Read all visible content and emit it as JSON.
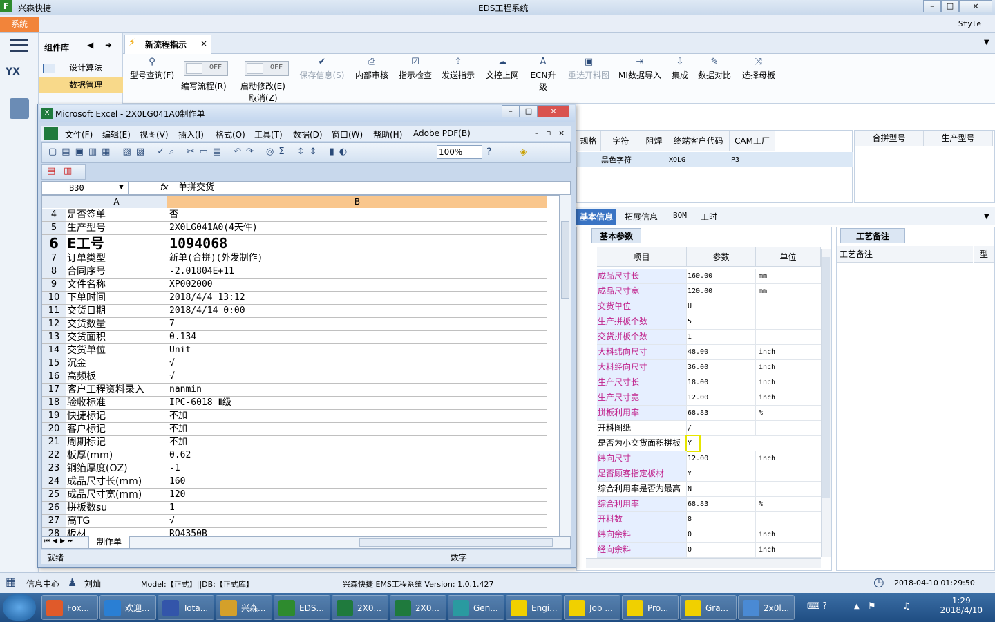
{
  "app": {
    "logo": "F",
    "name": "兴森快捷",
    "title": "EDS工程系统",
    "style_label": "Style"
  },
  "menu": {
    "system": "系统"
  },
  "left": {
    "component_lib": "组件库",
    "items": [
      {
        "label": "设计算法"
      },
      {
        "label": "数据管理"
      }
    ]
  },
  "tab": {
    "label": "新流程指示",
    "close": "×"
  },
  "toolbar": {
    "model_query": "型号查询(F)",
    "toggle1_state": "OFF",
    "toggle1_label": "编写流程(R)",
    "toggle2_state": "OFF",
    "toggle2_label": "启动修改(E)",
    "cancel": "取消(Z)",
    "save_info": "保存信息(S)",
    "internal_review": "内部审核",
    "check": "指示检查",
    "send": "发送指示",
    "doc_upload": "文控上网",
    "ecn": "ECN升级",
    "reselect": "重选开料图",
    "mi_import": "MI数据导入",
    "integrate": "集成",
    "compare": "数据对比",
    "select_mother": "选择母板"
  },
  "top_grid": {
    "headers": [
      "规格",
      "字符",
      "阻焊",
      "终端客户代码",
      "CAM工厂"
    ],
    "row": [
      "黑色字符",
      "",
      "XOLG",
      "P3"
    ]
  },
  "model_grid": {
    "headers": [
      "合拼型号",
      "生产型号"
    ]
  },
  "bottom_tabs": [
    "基本信息",
    "拓展信息",
    "BOM",
    "工时"
  ],
  "basic_params": {
    "tab": "基本参数",
    "headers": [
      "项目",
      "参数",
      "单位"
    ],
    "rows": [
      {
        "k": "成品尺寸长",
        "v": "160.00",
        "u": "mm",
        "red": true
      },
      {
        "k": "成品尺寸宽",
        "v": "120.00",
        "u": "mm",
        "red": true
      },
      {
        "k": "交货单位",
        "v": "U",
        "u": "",
        "red": true
      },
      {
        "k": "生产拼板个数",
        "v": "5",
        "u": "",
        "red": true
      },
      {
        "k": "交货拼板个数",
        "v": "1",
        "u": "",
        "red": true
      },
      {
        "k": "大料纬向尺寸",
        "v": "48.00",
        "u": "inch",
        "red": true
      },
      {
        "k": "大料经向尺寸",
        "v": "36.00",
        "u": "inch",
        "red": true
      },
      {
        "k": "生产尺寸长",
        "v": "18.00",
        "u": "inch",
        "red": true
      },
      {
        "k": "生产尺寸宽",
        "v": "12.00",
        "u": "inch",
        "red": true
      },
      {
        "k": "拼板利用率",
        "v": "68.83",
        "u": "%",
        "red": true
      },
      {
        "k": "开料图纸",
        "v": "/",
        "u": "",
        "red": false
      },
      {
        "k": "是否为小交货面积拼板",
        "v": "Y",
        "u": "",
        "red": false
      },
      {
        "k": "纬向尺寸",
        "v": "12.00",
        "u": "inch",
        "red": true
      },
      {
        "k": "是否顾客指定板材",
        "v": "Y",
        "u": "",
        "red": true
      },
      {
        "k": "综合利用率是否为最高",
        "v": "N",
        "u": "",
        "red": false
      },
      {
        "k": "综合利用率",
        "v": "68.83",
        "u": "%",
        "red": true
      },
      {
        "k": "开料数",
        "v": "8",
        "u": "",
        "red": true
      },
      {
        "k": "纬向余料",
        "v": "0",
        "u": "inch",
        "red": true
      },
      {
        "k": "经向余料",
        "v": "0",
        "u": "inch",
        "red": true
      }
    ]
  },
  "remark": {
    "tab": "工艺备注",
    "header": "工艺备注",
    "col": "型"
  },
  "status": {
    "info_center": "信息中心",
    "user": "刘灿",
    "model": "Model:【正式】||DB:【正式库】",
    "system": "兴森快捷 EMS工程系统 Version: 1.0.1.427",
    "datetime": "2018-04-10 01:29:50"
  },
  "excel": {
    "title": "Microsoft Excel - 2X0LG041A0制作单",
    "menus": [
      "文件(F)",
      "编辑(E)",
      "视图(V)",
      "插入(I)",
      "格式(O)",
      "工具(T)",
      "数据(D)",
      "窗口(W)",
      "帮助(H)",
      "Adobe PDF(B)"
    ],
    "zoom": "100%",
    "namebox": "B30",
    "fx": "fx",
    "formula": "单拼交货",
    "col_a": "A",
    "col_b": "B",
    "rows": [
      {
        "n": "4",
        "a": "是否签单",
        "b": "否"
      },
      {
        "n": "5",
        "a": "生产型号",
        "b": "2X0LG041A0(4天件)"
      },
      {
        "n": "6",
        "a": "E工号",
        "b": "1094068",
        "big": true
      },
      {
        "n": "7",
        "a": "订单类型",
        "b": "新单(合拼)(外发制作)"
      },
      {
        "n": "8",
        "a": "合同序号",
        "b": "-2.01804E+11"
      },
      {
        "n": "9",
        "a": "文件名称",
        "b": "XP002000"
      },
      {
        "n": "10",
        "a": "下单时间",
        "b": "2018/4/4 13:12"
      },
      {
        "n": "11",
        "a": "交货日期",
        "b": "2018/4/14 0:00"
      },
      {
        "n": "12",
        "a": "交货数量",
        "b": "7"
      },
      {
        "n": "13",
        "a": "交货面积",
        "b": "0.134"
      },
      {
        "n": "14",
        "a": "交货单位",
        "b": "Unit"
      },
      {
        "n": "15",
        "a": "沉金",
        "b": "√"
      },
      {
        "n": "16",
        "a": "高频板",
        "b": "√"
      },
      {
        "n": "17",
        "a": "客户工程资料录入",
        "b": "nanmin"
      },
      {
        "n": "18",
        "a": "验收标准",
        "b": "IPC-6018 Ⅱ级"
      },
      {
        "n": "19",
        "a": "快捷标记",
        "b": "不加"
      },
      {
        "n": "20",
        "a": "客户标记",
        "b": "不加"
      },
      {
        "n": "21",
        "a": "周期标记",
        "b": "不加"
      },
      {
        "n": "22",
        "a": "板厚(mm)",
        "b": "0.62"
      },
      {
        "n": "23",
        "a": "铜箔厚度(OZ)",
        "b": "-1"
      },
      {
        "n": "24",
        "a": "成品尺寸长(mm)",
        "b": "160"
      },
      {
        "n": "25",
        "a": "成品尺寸宽(mm)",
        "b": "120"
      },
      {
        "n": "26",
        "a": "拼板数su",
        "b": "1"
      },
      {
        "n": "27",
        "a": "高TG",
        "b": "√"
      },
      {
        "n": "28",
        "a": "板材",
        "b": "RO4350B"
      }
    ],
    "sheet_tab": "制作单",
    "status_ready": "就绪",
    "status_num": "数字"
  },
  "taskbar": {
    "items": [
      "Fox...",
      "欢迎...",
      "Tota...",
      "兴森...",
      "EDS...",
      "2X0...",
      "2X0...",
      "Gen...",
      "Engi...",
      "Job ...",
      "Pro...",
      "Gra...",
      "2x0l..."
    ],
    "time": "1:29",
    "date": "2018/4/10"
  }
}
